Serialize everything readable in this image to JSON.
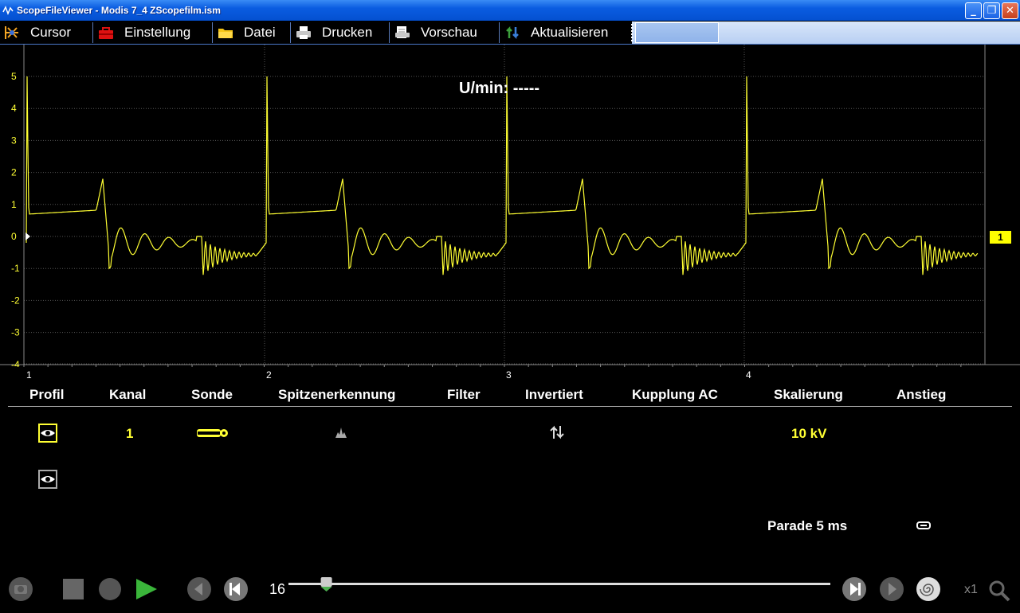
{
  "window": {
    "title": "ScopeFileViewer - Modis 7_4 ZScopefilm.ism",
    "minimize": "_",
    "maximize": "❐",
    "close": "✕"
  },
  "menu": [
    {
      "label": "Cursor",
      "icon": "cursor-tool-icon"
    },
    {
      "label": "Einstellung",
      "icon": "toolbox-icon"
    },
    {
      "label": "Datei",
      "icon": "folder-icon"
    },
    {
      "label": "Drucken",
      "icon": "printer-icon"
    },
    {
      "label": "Vorschau",
      "icon": "preview-icon"
    },
    {
      "label": "Aktualisieren",
      "icon": "refresh-icon"
    }
  ],
  "scope": {
    "rpm_label": "U/min: -----",
    "y_ticks": [
      "5",
      "4",
      "3",
      "2",
      "1",
      "0",
      "-1",
      "-2",
      "-3",
      "-4"
    ],
    "segments": [
      "1",
      "2",
      "3",
      "4"
    ],
    "channel_marker": "1",
    "trace_color": "#ffff33",
    "grid_color": "#555555"
  },
  "table": {
    "headers": [
      "Profil",
      "Kanal",
      "Sonde",
      "Spitzenerkennung",
      "Filter",
      "Invertiert",
      "Kupplung AC",
      "Skalierung",
      "Anstieg"
    ],
    "row1": {
      "kanal": "1",
      "skalierung": "10 kV"
    },
    "parade": "Parade 5 ms"
  },
  "playback": {
    "frame": "16",
    "zoom": "x1",
    "slider_position": 0.07
  }
}
